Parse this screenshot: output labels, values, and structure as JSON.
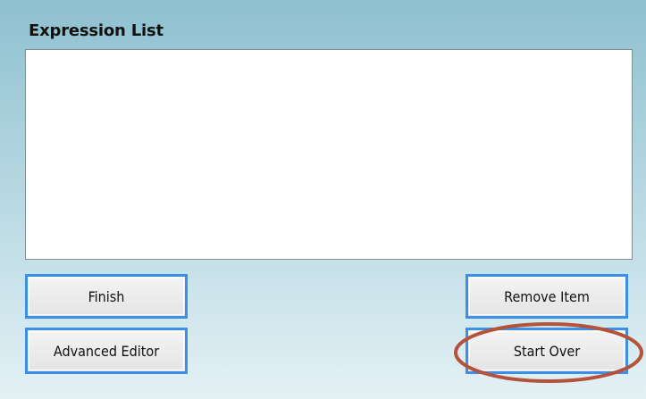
{
  "panel": {
    "title": "Expression List"
  },
  "expression_list": {
    "items": []
  },
  "buttons": {
    "finish_label": "Finish",
    "advanced_editor_label": "Advanced Editor",
    "remove_item_label": "Remove Item",
    "start_over_label": "Start Over"
  },
  "colors": {
    "button_border": "#3b8fe8",
    "annotation_ellipse": "#b5523a",
    "background_top": "#8ec0cf",
    "background_bottom": "#e4f1f5"
  },
  "annotation": {
    "highlighted_target": "start-over-button"
  }
}
